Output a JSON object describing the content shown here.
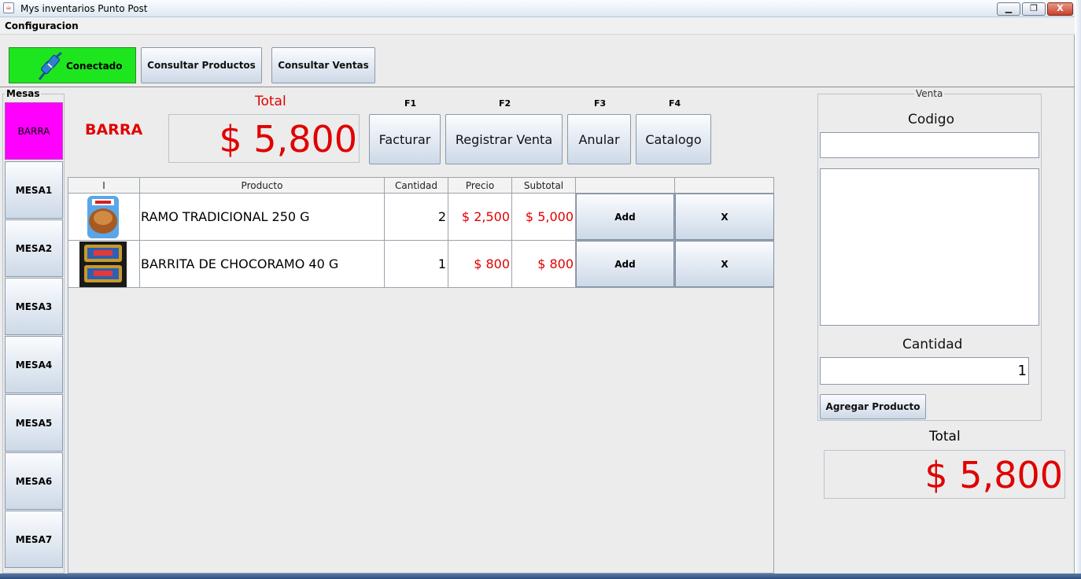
{
  "window": {
    "title": "Mys inventarios Punto Post",
    "min": "▁",
    "max": "❐",
    "close": "X"
  },
  "menu": {
    "configuracion": "Configuracion"
  },
  "toolbar": {
    "status": "Conectado",
    "consultar_productos": "Consultar Productos",
    "consultar_ventas": "Consultar Ventas"
  },
  "mesas": {
    "legend": "Mesas",
    "items": [
      "BARRA",
      "MESA1",
      "MESA2",
      "MESA3",
      "MESA4",
      "MESA5",
      "MESA6",
      "MESA7"
    ]
  },
  "current": {
    "table_name": "BARRA",
    "total_label": "Total",
    "total_value": "$ 5,800"
  },
  "actions": [
    {
      "key": "F1",
      "label": "Facturar"
    },
    {
      "key": "F2",
      "label": "Registrar Venta"
    },
    {
      "key": "F3",
      "label": "Anular"
    },
    {
      "key": "F4",
      "label": "Catalogo"
    }
  ],
  "table": {
    "headers": [
      "I",
      "Producto",
      "Cantidad",
      "Precio",
      "Subtotal",
      "",
      ""
    ],
    "rows": [
      {
        "producto": "RAMO TRADICIONAL 250 G",
        "cantidad": "2",
        "precio": "$ 2,500",
        "subtotal": "$ 5,000",
        "add": "Add",
        "remove": "X"
      },
      {
        "producto": "BARRITA DE CHOCORAMO 40 G",
        "cantidad": "1",
        "precio": "$ 800",
        "subtotal": "$ 800",
        "add": "Add",
        "remove": "X"
      }
    ]
  },
  "venta": {
    "legend": "Venta",
    "codigo_label": "Codigo",
    "codigo_value": "",
    "cantidad_label": "Cantidad",
    "cantidad_value": "1",
    "agregar": "Agregar Producto"
  },
  "summary": {
    "total_label": "Total",
    "total_value": "$ 5,800"
  },
  "colors": {
    "status_green": "#1ee61e",
    "selected_mesa": "#ff00ff",
    "money_red": "#e00000"
  }
}
